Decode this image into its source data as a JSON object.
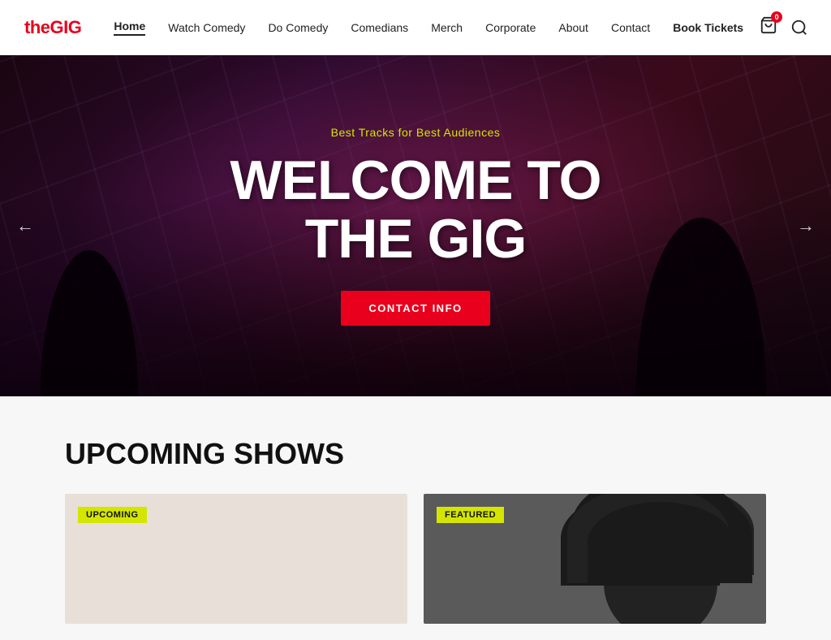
{
  "site": {
    "logo_prefix": "the",
    "logo_highlight": "GIG"
  },
  "nav": {
    "items": [
      {
        "label": "Home",
        "active": true
      },
      {
        "label": "Watch Comedy",
        "active": false
      },
      {
        "label": "Do Comedy",
        "active": false
      },
      {
        "label": "Comedians",
        "active": false
      },
      {
        "label": "Merch",
        "active": false
      },
      {
        "label": "Corporate",
        "active": false
      },
      {
        "label": "About",
        "active": false
      },
      {
        "label": "Contact",
        "active": false
      }
    ],
    "book_tickets": "Book Tickets",
    "cart_count": "0"
  },
  "hero": {
    "subtitle": "Best Tracks for Best Audiences",
    "title_line1": "WELCOME TO",
    "title_line2": "THE GIG",
    "cta_label": "CONTACT INFO",
    "arrow_left": "←",
    "arrow_right": "→"
  },
  "upcoming": {
    "section_title": "UPCOMING SHOWS",
    "cards": [
      {
        "badge": "UPCOMING"
      },
      {
        "badge": "FEATURED"
      }
    ]
  }
}
